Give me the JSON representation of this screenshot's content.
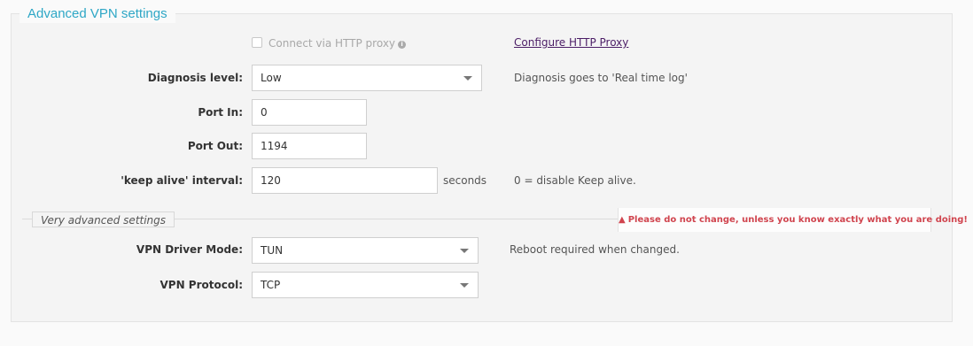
{
  "section": {
    "title": "Advanced VPN settings",
    "proxy": {
      "checkbox_label": "Connect via HTTP proxy",
      "checked": false,
      "info_icon": "info-circle-icon",
      "configure_link": "Configure HTTP Proxy"
    },
    "diagnosis": {
      "label": "Diagnosis level:",
      "value": "Low",
      "hint": "Diagnosis goes to 'Real time log'"
    },
    "port_in": {
      "label": "Port In:",
      "value": "0"
    },
    "port_out": {
      "label": "Port Out:",
      "value": "1194"
    },
    "keep_alive": {
      "label": "'keep alive' interval:",
      "value": "120",
      "unit": "seconds",
      "hint": "0 = disable Keep alive."
    }
  },
  "very_advanced": {
    "title": "Very advanced settings",
    "warning": "Please do not change, unless you know exactly what you are doing!",
    "warning_icon": "warning-triangle-icon",
    "driver_mode": {
      "label": "VPN Driver Mode:",
      "value": "TUN",
      "hint": "Reboot required when changed."
    },
    "protocol": {
      "label": "VPN Protocol:",
      "value": "TCP"
    }
  },
  "colors": {
    "accent": "#2ea7c6",
    "link": "#4b1d66",
    "warning": "#d0444e"
  }
}
